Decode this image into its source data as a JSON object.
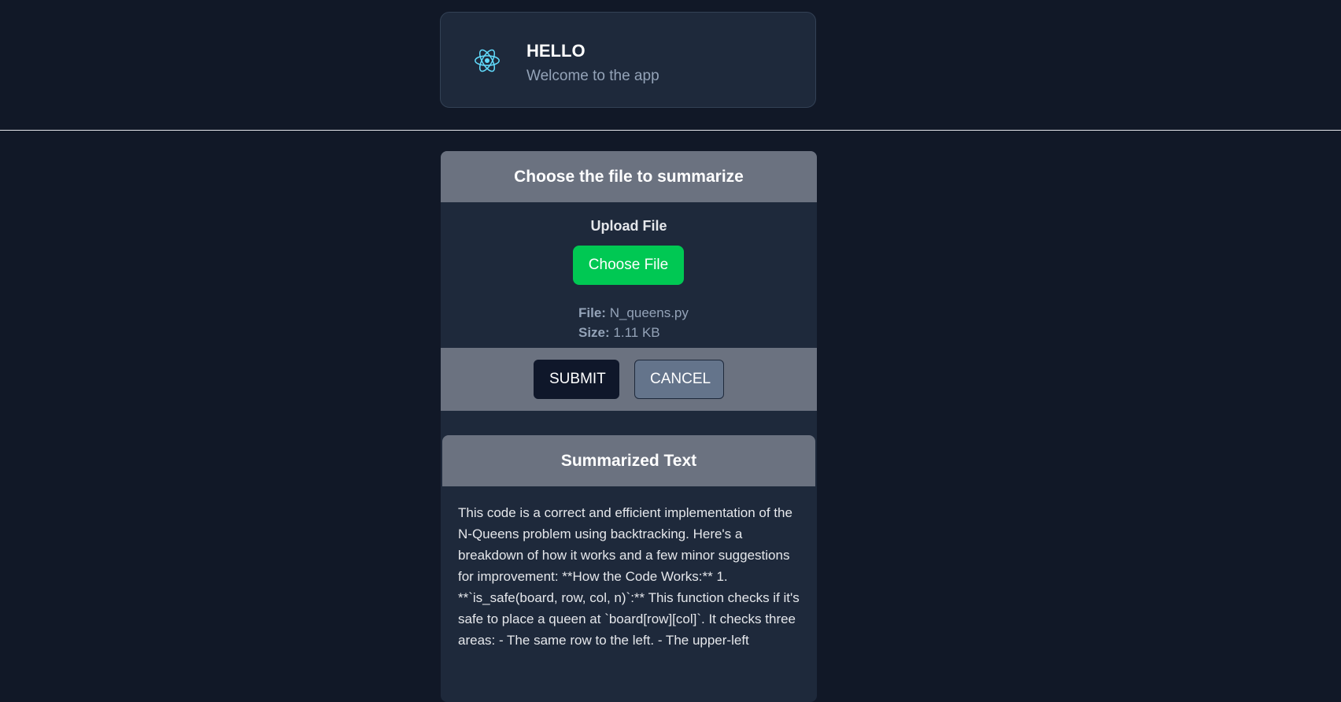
{
  "header": {
    "icon": "react-atom-icon",
    "title": "HELLO",
    "subtitle": "Welcome to the app",
    "icon_color": "#61dafb"
  },
  "upload_card": {
    "title": "Choose the file to summarize",
    "upload_label": "Upload File",
    "choose_button": "Choose File",
    "file_label": "File:",
    "file_name": "N_queens.py",
    "size_label": "Size:",
    "file_size": "1.11 KB",
    "submit": "SUBMIT",
    "cancel": "CANCEL",
    "accent_color": "#00c853"
  },
  "summary": {
    "title": "Summarized Text",
    "text": "This code is a correct and efficient implementation of the N-Queens problem using backtracking. Here's a breakdown of how it works and a few minor suggestions for improvement: **How the Code Works:** 1. **`is_safe(board, row, col, n)`:** This function checks if it's safe to place a queen at `board[row][col]`. It checks three areas: - The same row to the left. - The upper-left"
  }
}
